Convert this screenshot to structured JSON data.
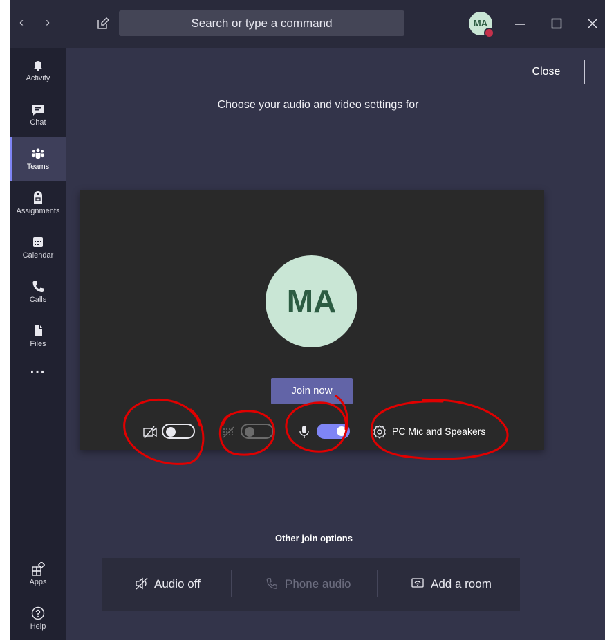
{
  "titlebar": {
    "back_icon": "chevron-left-icon",
    "forward_icon": "chevron-right-icon",
    "compose_icon": "new-chat-icon",
    "search_placeholder": "Search or type a command",
    "avatar_initials": "MA",
    "minimize_icon": "minimize-icon",
    "maximize_icon": "maximize-icon",
    "close_icon": "close-icon"
  },
  "rail": {
    "items": [
      {
        "label": "Activity",
        "icon": "bell-icon"
      },
      {
        "label": "Chat",
        "icon": "chat-icon"
      },
      {
        "label": "Teams",
        "icon": "teams-icon",
        "active": true
      },
      {
        "label": "Assignments",
        "icon": "assignments-icon"
      },
      {
        "label": "Calendar",
        "icon": "calendar-icon"
      },
      {
        "label": "Calls",
        "icon": "phone-icon"
      },
      {
        "label": "Files",
        "icon": "files-icon"
      }
    ],
    "more": "...",
    "bottom": [
      {
        "label": "Apps",
        "icon": "apps-icon"
      },
      {
        "label": "Help",
        "icon": "help-icon"
      }
    ]
  },
  "main": {
    "close_label": "Close",
    "heading": "Choose your audio and video settings for",
    "avatar_initials": "MA",
    "join_label": "Join now",
    "controls": {
      "camera": {
        "icon": "camera-off-icon",
        "on": false
      },
      "blur": {
        "icon": "background-blur-icon",
        "on": false,
        "disabled": true
      },
      "mic": {
        "icon": "microphone-icon",
        "on": true
      },
      "device_label": "PC Mic and Speakers",
      "device_icon": "gear-icon"
    },
    "other": {
      "title": "Other join options",
      "options": [
        {
          "label": "Audio off",
          "icon": "speaker-off-icon"
        },
        {
          "label": "Phone audio",
          "icon": "phone-icon",
          "disabled": true
        },
        {
          "label": "Add a room",
          "icon": "cast-icon"
        }
      ]
    }
  },
  "colors": {
    "accent": "#6264a7",
    "toggle_on": "#7f85f5",
    "annotation": "#e00000"
  }
}
